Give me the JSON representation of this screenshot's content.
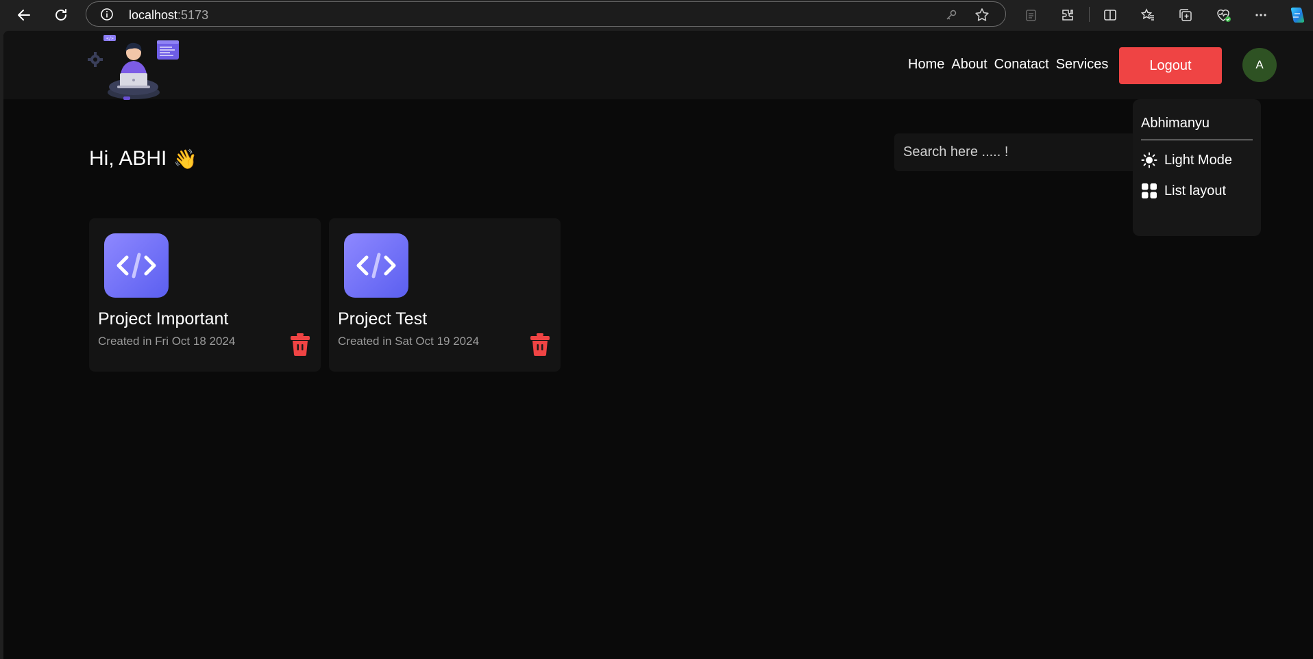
{
  "browser": {
    "url_host": "localhost",
    "url_port": ":5173"
  },
  "nav": {
    "links": [
      "Home",
      "About",
      "Conatact",
      "Services"
    ],
    "logout_label": "Logout",
    "avatar_initial": "A"
  },
  "greeting": {
    "text": "Hi, ABHI",
    "emoji": "👋"
  },
  "search": {
    "placeholder": "Search here ..... !"
  },
  "projects": [
    {
      "title": "Project Important",
      "created": "Created in Fri Oct 18 2024"
    },
    {
      "title": "Project Test",
      "created": "Created in Sat Oct 19 2024"
    }
  ],
  "dropdown": {
    "username": "Abhimanyu",
    "items": [
      {
        "label": "Light Mode",
        "icon": "sun-icon"
      },
      {
        "label": "List layout",
        "icon": "grid-icon"
      }
    ]
  },
  "colors": {
    "accent_red": "#ef4444",
    "avatar_green": "#2e5223",
    "project_icon_gradient_start": "#8e88ff",
    "project_icon_gradient_end": "#5b5ff0"
  }
}
